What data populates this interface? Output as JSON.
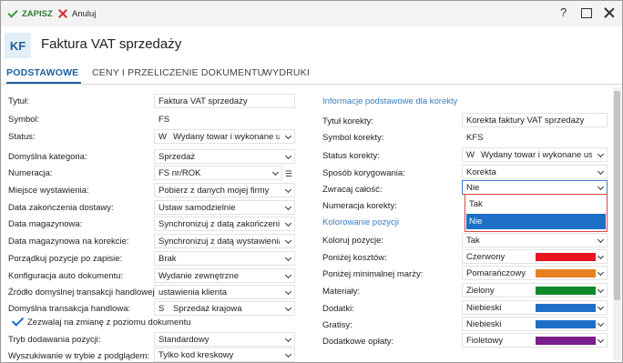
{
  "toolbar": {
    "save_label": "ZAPISZ",
    "cancel_label": "Anuluj",
    "help_label": "?"
  },
  "header": {
    "logo": "KF",
    "title": "Faktura VAT sprzedaży"
  },
  "tabs": [
    {
      "label": "PODSTAWOWE",
      "active": true
    },
    {
      "label": "CENY I PRZELICZENIE DOKUMENTU",
      "active": false
    },
    {
      "label": "WYDRUKI",
      "active": false
    }
  ],
  "left": {
    "titul": {
      "label": "Tytuł:",
      "value": "Faktura VAT sprzedaży"
    },
    "symbol": {
      "label": "Symbol:",
      "value": "FS"
    },
    "status": {
      "label": "Status:",
      "code": "W",
      "value": "Wydany towar i wykonane u..."
    },
    "kategoria": {
      "label": "Domyślna kategoria:",
      "value": "Sprzedaż"
    },
    "numeracja": {
      "label": "Numeracja:",
      "value": "FS nr/ROK"
    },
    "miejsce": {
      "label": "Miejsce wystawienia:",
      "value": "Pobierz z danych mojej firmy"
    },
    "data_zak": {
      "label": "Data zakończenia dostawy:",
      "value": "Ustaw samodzielnie"
    },
    "data_mag": {
      "label": "Data magazynowa:",
      "value": "Synchronizuj z datą zakończenia do"
    },
    "data_mag_kor": {
      "label": "Data magazynowa na korekcie:",
      "value": "Synchronizuj z datą wystawienia do"
    },
    "porzadkuj": {
      "label": "Porządkuj pozycje po zapisie:",
      "value": "Brak"
    },
    "konfig": {
      "label": "Konfiguracja auto dokumentu:",
      "value": "Wydanie zewnętrzne"
    },
    "zrodlo": {
      "label": "Źródło domyślnej transakcji handlowej:",
      "value": "ustawienia klienta"
    },
    "transakcja": {
      "label": "Domyślna transakcja handlowa:",
      "code": "S",
      "value": "Sprzedaż krajowa"
    },
    "zezwalaj": {
      "label": "Zezwalaj na zmianę z poziomu dokumentu",
      "checked": true
    },
    "tryb": {
      "label": "Tryb dodawania pozycji:",
      "value": "Standardowy"
    },
    "wyszukiwanie": {
      "label": "Wyszukiwanie w trybie z podglądem:",
      "value": "Tylko kod kreskowy"
    }
  },
  "right": {
    "section1": "Informacje podstawowe dla korekty",
    "tytul_kor": {
      "label": "Tytuł korekty:",
      "value": "Korekta faktury VAT sprzedaży"
    },
    "symbol_kor": {
      "label": "Symbol korekty:",
      "value": "KFS"
    },
    "status_kor": {
      "label": "Status korekty:",
      "code": "W",
      "value": "Wydany towar i wykonane usług"
    },
    "sposob": {
      "label": "Sposób korygowania:",
      "value": "Korekta"
    },
    "zwracaj": {
      "label": "Zwracaj całość:",
      "value": "Nie"
    },
    "numeracja_kor": {
      "label": "Numeracja korekty:"
    },
    "section2": "Kolorowanie pozycji",
    "koloruj": {
      "label": "Koloruj pozycje:",
      "value": "Tak"
    },
    "ponizej_kosztow": {
      "label": "Poniżej kosztów:",
      "value": "Czerwony",
      "color": "#e8141e"
    },
    "ponizej_marzy": {
      "label": "Poniżej minimalnej marży:",
      "value": "Pomarańczowy",
      "color": "#e8801e"
    },
    "materialy": {
      "label": "Materiały:",
      "value": "Zielony",
      "color": "#128a2a"
    },
    "dodatki": {
      "label": "Dodatki:",
      "value": "Niebieski",
      "color": "#1e6fc8"
    },
    "gratisy": {
      "label": "Gratisy:",
      "value": "Niebieski",
      "color": "#1e6fc8"
    },
    "dodatkowe": {
      "label": "Dodatkowe opłaty:",
      "value": "Fioletowy",
      "color": "#7a1e8c"
    }
  },
  "dropdown": {
    "options": [
      "Tak",
      "Nie"
    ],
    "selected": "Nie"
  }
}
